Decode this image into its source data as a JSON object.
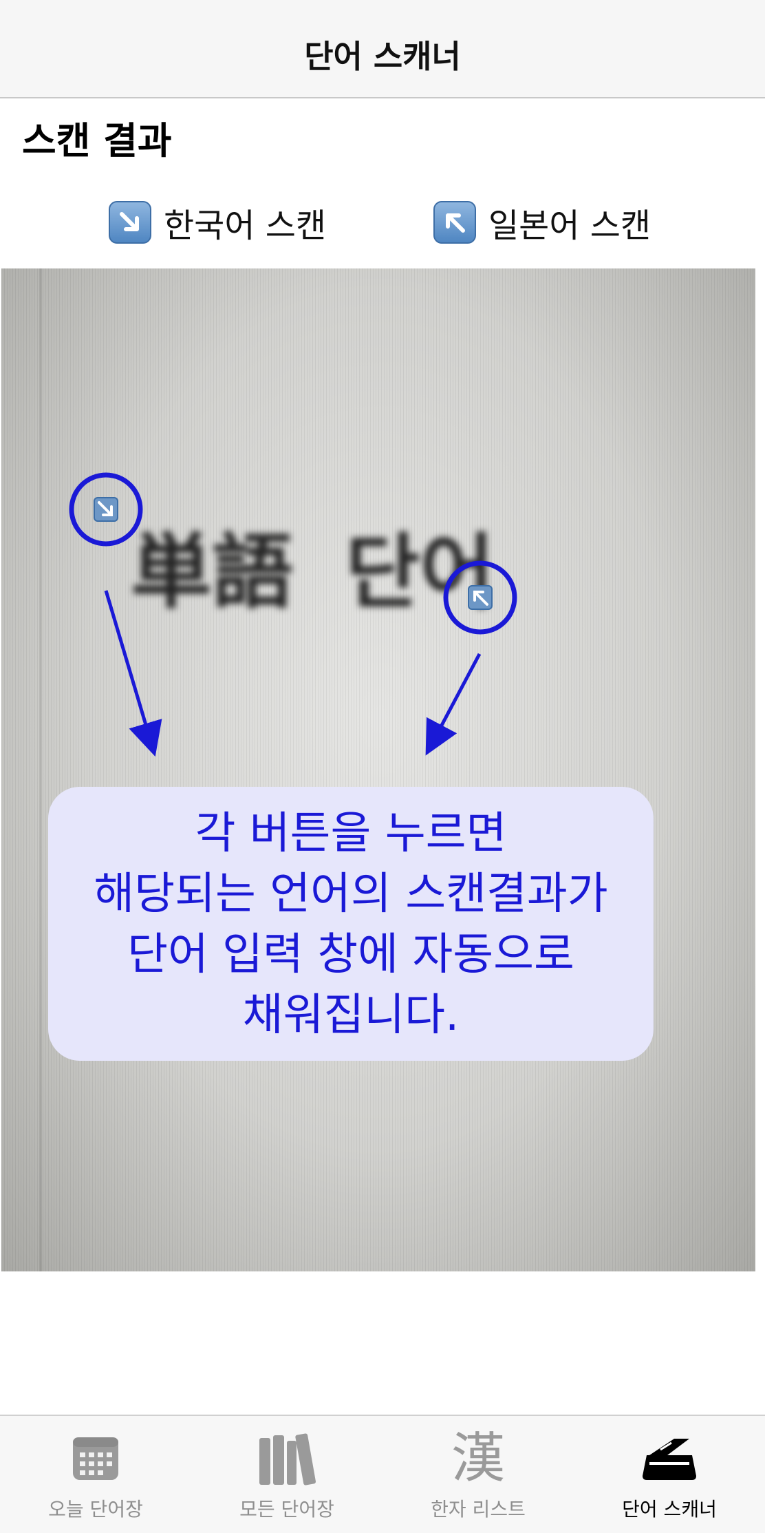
{
  "navbar": {
    "title": "단어 스캐너"
  },
  "section": {
    "title": "스캔 결과"
  },
  "scan_buttons": {
    "korean": {
      "label": "한국어 스캔",
      "icon": "down-right-arrow-icon"
    },
    "japanese": {
      "label": "일본어 스캔",
      "icon": "up-left-arrow-icon"
    }
  },
  "photo": {
    "words": [
      "単語",
      "단어"
    ]
  },
  "callout": {
    "lines": [
      "각 버튼을 누르면",
      "해당되는 언어의 스캔결과가",
      "단어 입력 창에 자동으로",
      "채워집니다."
    ],
    "color": "#1a19d6"
  },
  "tabbar": {
    "items": [
      {
        "label": "오늘 단어장",
        "icon": "calendar-icon",
        "active": false
      },
      {
        "label": "모든 단어장",
        "icon": "books-icon",
        "active": false
      },
      {
        "label": "한자 리스트",
        "icon": "kanji-icon",
        "glyph": "漢",
        "active": false
      },
      {
        "label": "단어 스캐너",
        "icon": "scanner-icon",
        "active": true
      }
    ]
  },
  "colors": {
    "accent": "#1a19d6",
    "navbar_bg": "#f6f6f6",
    "tab_inactive": "#8e8e8e"
  }
}
